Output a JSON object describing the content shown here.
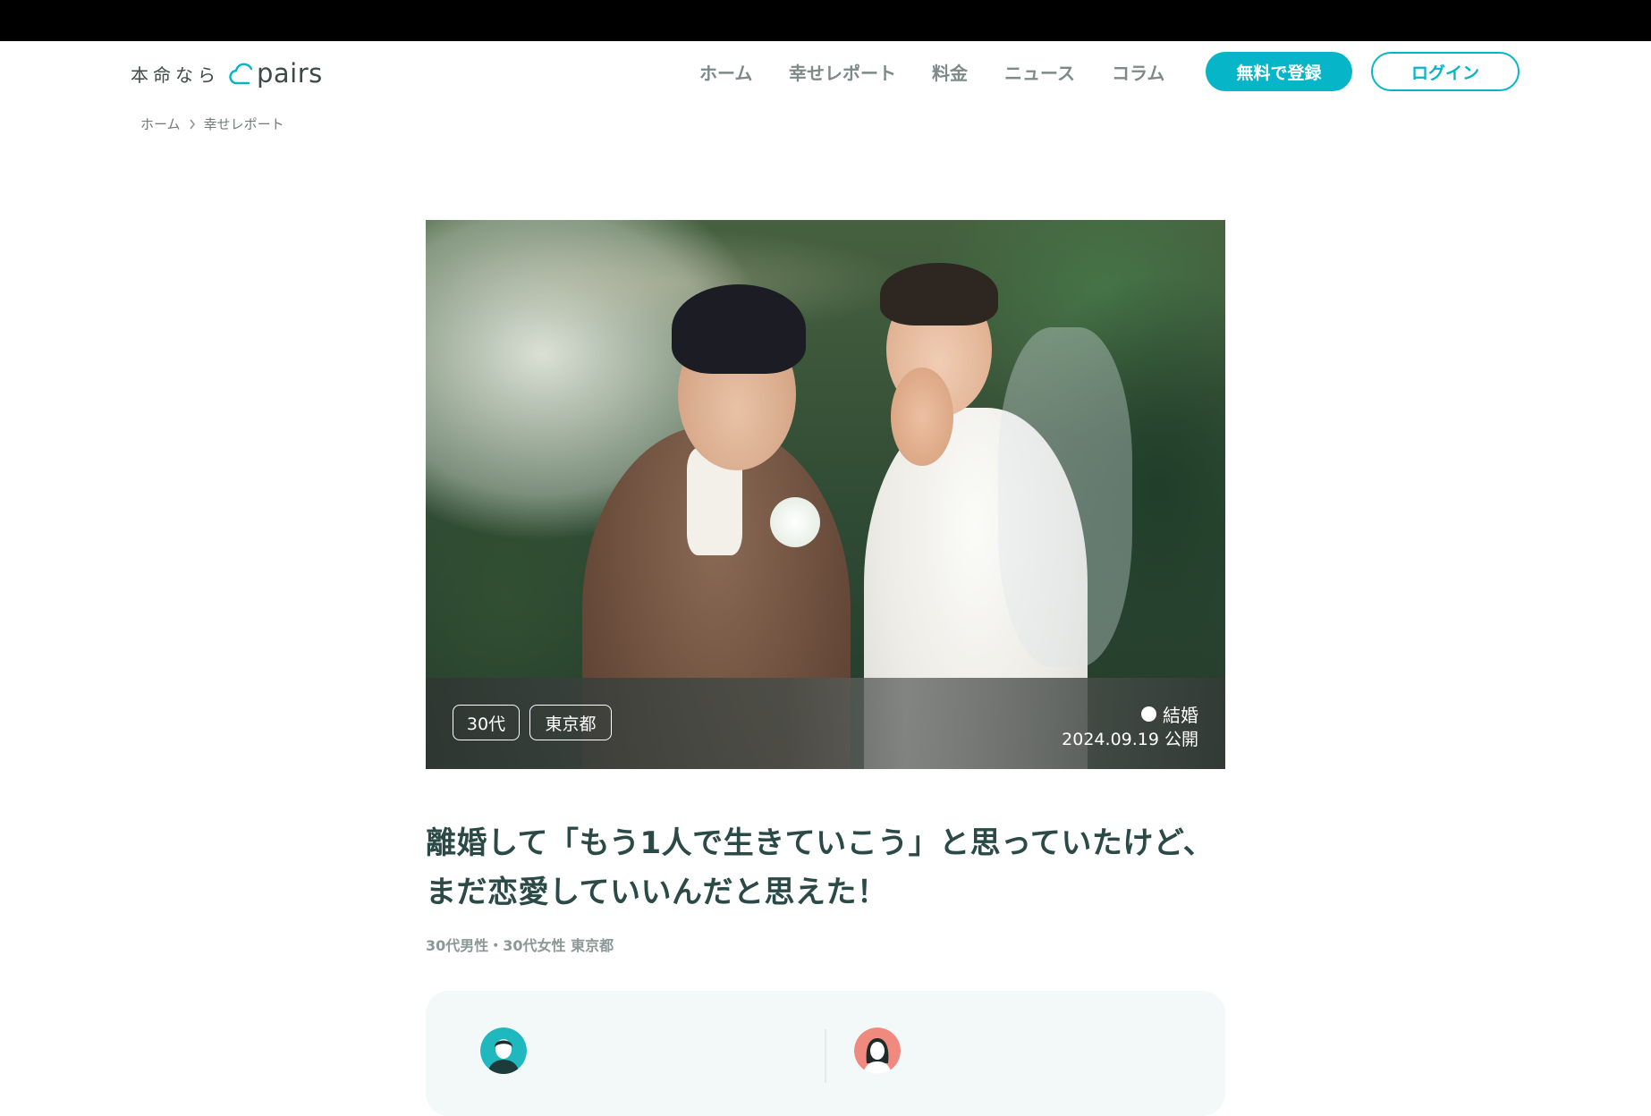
{
  "header": {
    "logo_tagline": "本命なら",
    "logo_word": "pairs",
    "nav": [
      {
        "label": "ホーム"
      },
      {
        "label": "幸せレポート"
      },
      {
        "label": "料金"
      },
      {
        "label": "ニュース"
      },
      {
        "label": "コラム"
      }
    ],
    "register_label": "無料で登録",
    "login_label": "ログイン"
  },
  "breadcrumb": [
    {
      "label": "ホーム"
    },
    {
      "label": "幸せレポート"
    }
  ],
  "hero": {
    "tags": [
      {
        "label": "30代"
      },
      {
        "label": "東京都"
      }
    ],
    "status_label": "結婚",
    "published": "2024.09.19 公開"
  },
  "article": {
    "title_line1": "離婚して「もう1人で生きていこう」と思っていたけど、",
    "title_line2": "まだ恋愛していいんだと思えた！",
    "meta": "30代男性・30代女性 東京都"
  },
  "colors": {
    "accent": "#06b5c8",
    "title_text": "#2b4a47",
    "card_bg": "#f2f9f8"
  }
}
